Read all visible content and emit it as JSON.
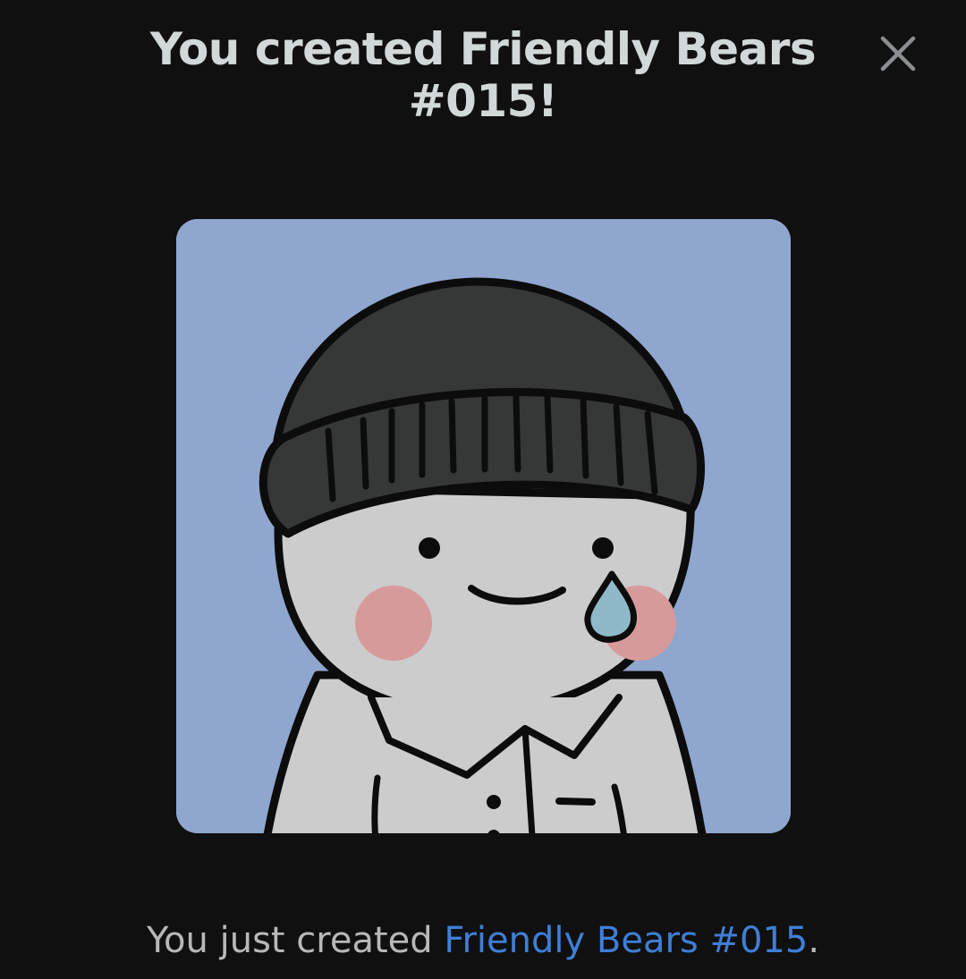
{
  "modal": {
    "title": "You created Friendly Bears #015!",
    "close_icon": "close-icon",
    "image_subject": "Friendly Bears #015",
    "caption": {
      "prefix": "You just created ",
      "link_text": "Friendly Bears #015",
      "suffix": "."
    }
  },
  "colors": {
    "background": "#101010",
    "title_text": "#d2d8d8",
    "caption_text": "#b8b8b8",
    "link": "#3f7fd6",
    "image_background": "#8fa6cf",
    "beanie": "#363838",
    "face": "#cccccc",
    "blush": "#d79a9a",
    "tear": "#8fb9c8"
  }
}
